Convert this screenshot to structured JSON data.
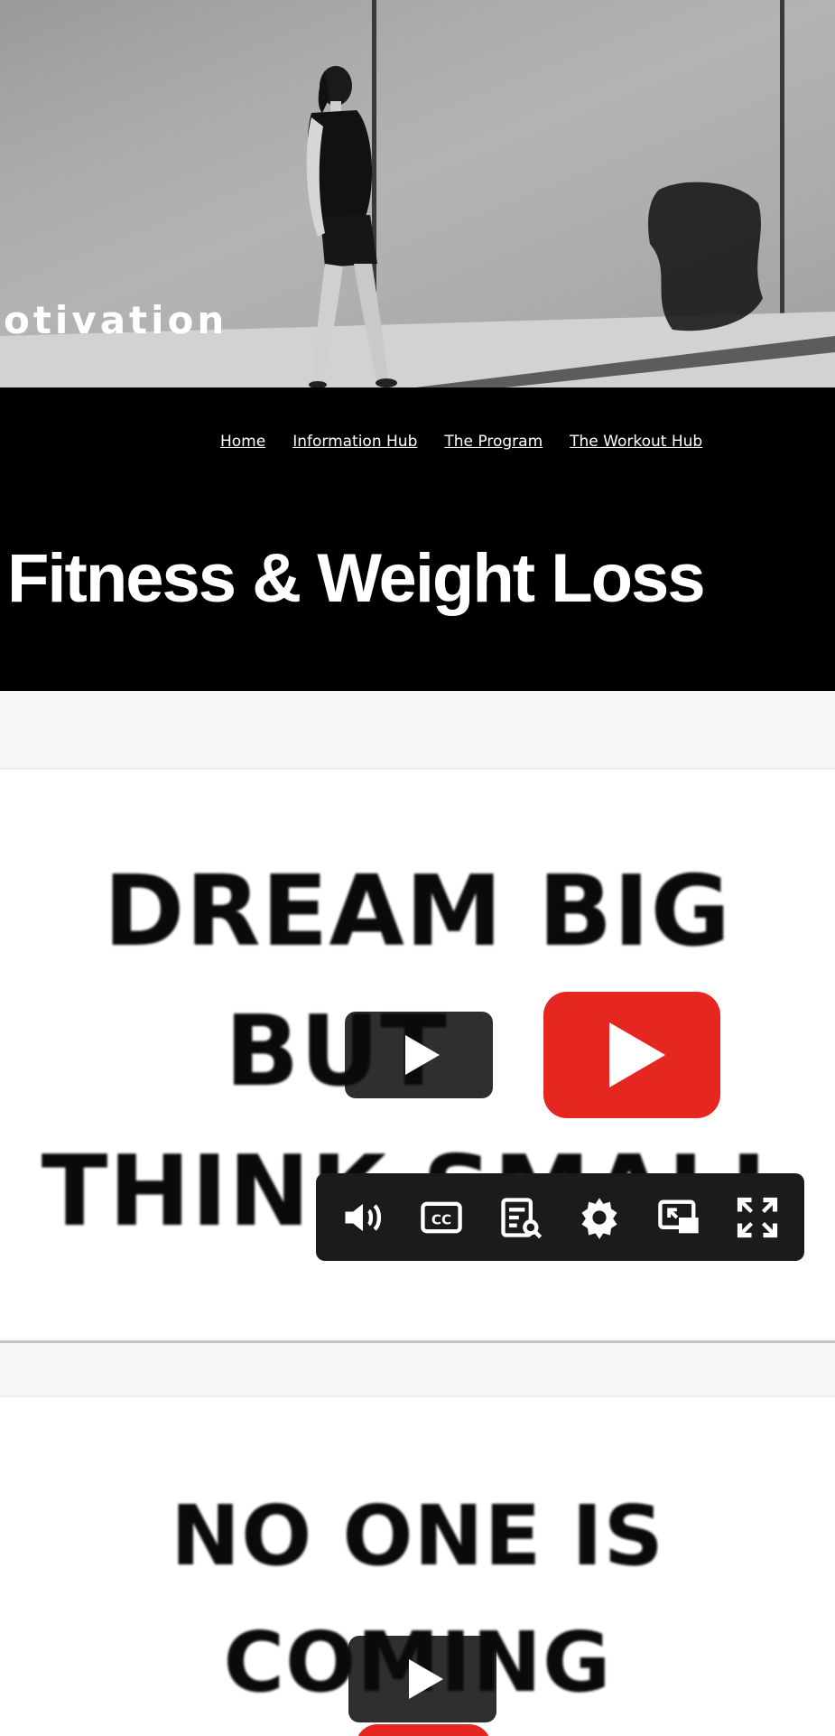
{
  "hero": {
    "text": "otivation"
  },
  "nav": {
    "items": [
      {
        "label": "Home"
      },
      {
        "label": "Information Hub"
      },
      {
        "label": "The Program"
      },
      {
        "label": "The Workout Hub"
      }
    ]
  },
  "page": {
    "title": "Fitness & Weight Loss"
  },
  "videos": [
    {
      "thumbnail_lines": [
        "DREAM BIG",
        "BUT",
        "THINK SMALL"
      ],
      "controls": [
        "volume-icon",
        "captions-icon",
        "transcript-icon",
        "settings-icon",
        "picture-in-picture-icon",
        "fullscreen-icon"
      ]
    },
    {
      "thumbnail_lines": [
        "NO ONE IS",
        "COMING"
      ]
    }
  ],
  "colors": {
    "header_bg": "#000000",
    "youtube_red": "#e62621",
    "page_bg": "#f6f6f6"
  }
}
